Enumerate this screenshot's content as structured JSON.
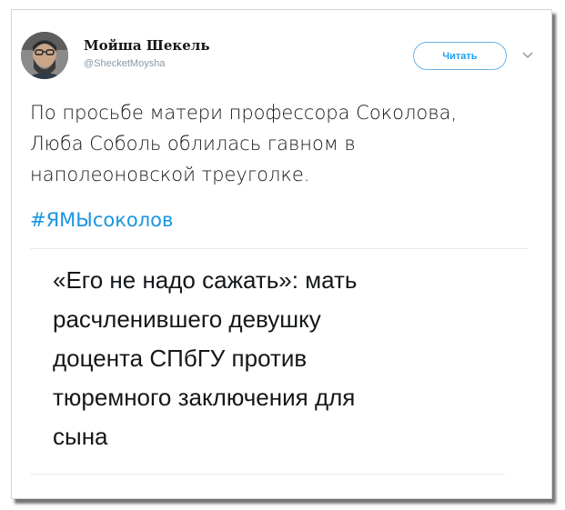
{
  "author": {
    "display_name": "Мойша Шекель",
    "handle": "@ShecketMoysha"
  },
  "follow_button": {
    "label": "Читать"
  },
  "icons": {
    "more": "chevron-down-icon",
    "avatar": "user-avatar-photo"
  },
  "tweet": {
    "lines": [
      "По просьбе матери профессора Соколова,",
      "Люба Соболь облилась гавном в",
      "наполеоновской треуголке."
    ],
    "hashtag": "#ЯМЫсоколов"
  },
  "card": {
    "title_lines": [
      "«Его не надо сажать»: мать",
      "расчленившего девушку",
      "доцента СПбГУ против",
      "тюремного заключения для",
      "сына"
    ]
  },
  "colors": {
    "accent": "#1da1f2",
    "hashtag": "#1b95e0",
    "text": "#14171a",
    "muted": "#8899a6"
  }
}
